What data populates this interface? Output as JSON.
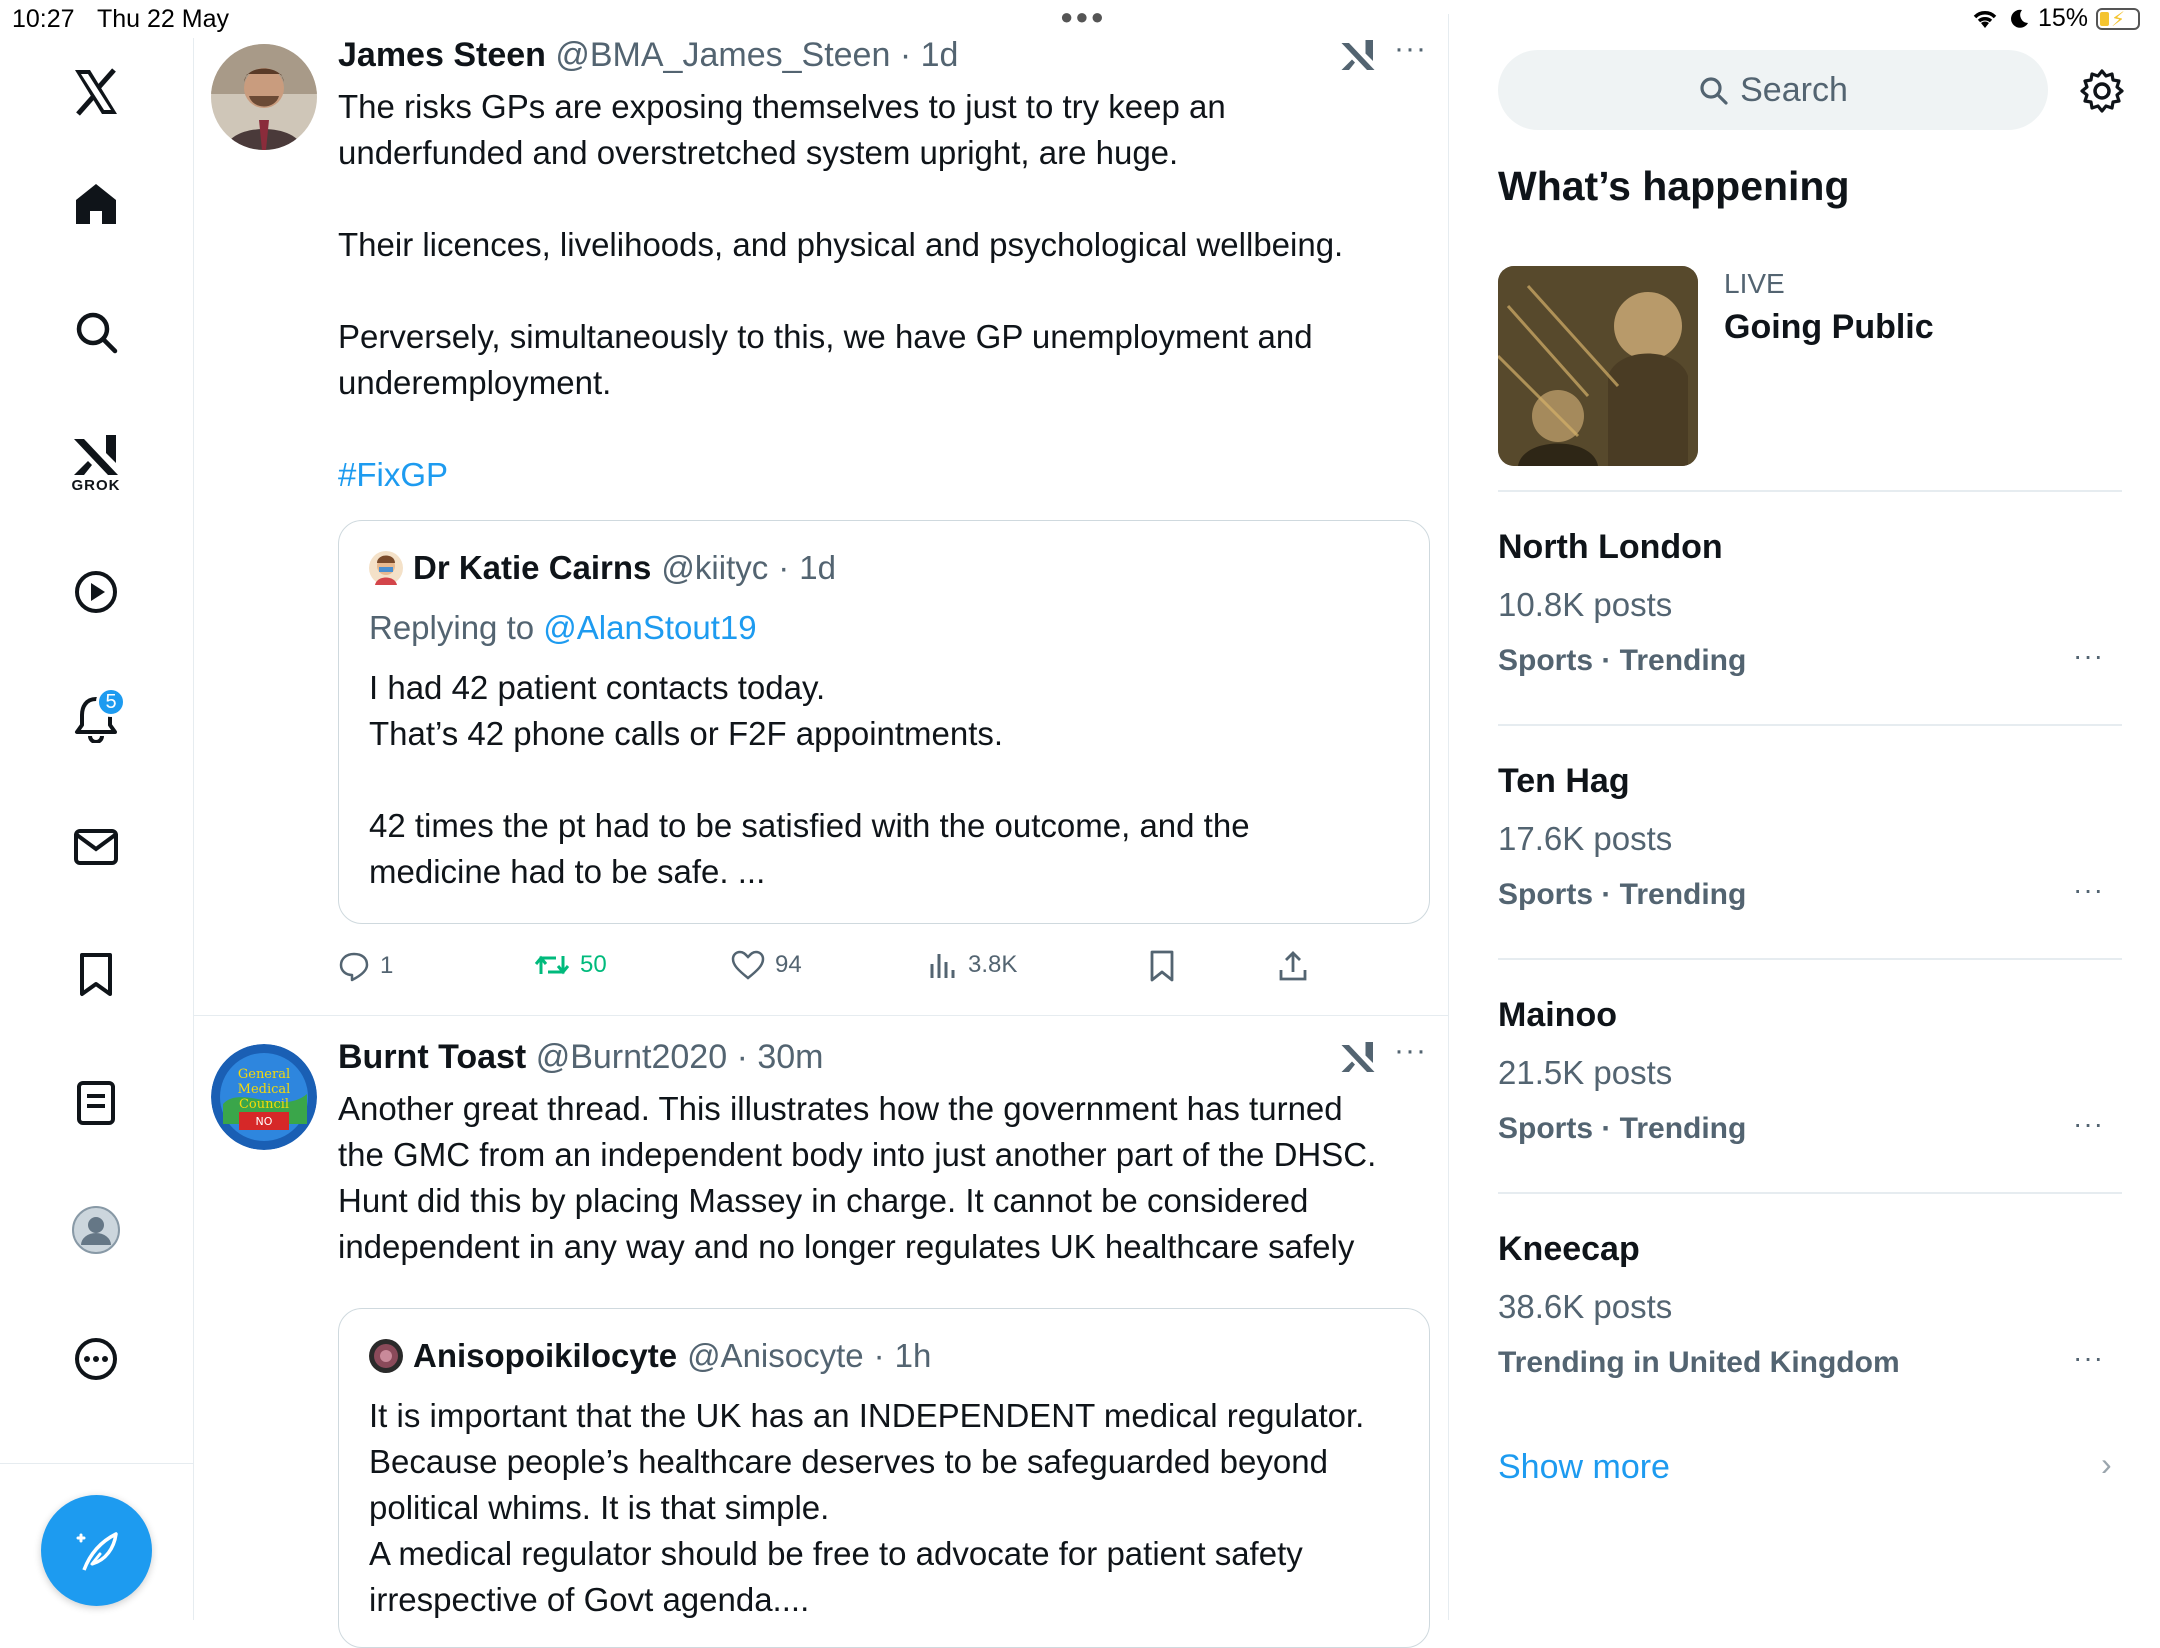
{
  "status_bar": {
    "time": "10:27",
    "date": "Thu 22 May",
    "battery": "15%"
  },
  "nav": {
    "grok_label": "GROK",
    "notifications_badge": "5"
  },
  "posts": [
    {
      "name": "James Steen",
      "handle": "@BMA_James_Steen",
      "age": "1d",
      "text": "The risks GPs are exposing themselves to just to try keep an\nunderfunded and overstretched system upright, are huge.\n\nTheir licences, livelihoods, and physical and psychological wellbeing.\n\nPerversely, simultaneously to this, we have GP unemployment and\nunderemployment.",
      "hashtag": "#FixGP",
      "quote": {
        "name": "Dr Katie Cairns",
        "handle": "@kiityc",
        "age": "1d",
        "replying_prefix": "Replying to ",
        "replying_to": "@AlanStout19",
        "text": "I had 42 patient contacts today.\nThat’s 42 phone calls or F2F appointments.\n\n42 times the pt had to be satisfied with the outcome, and the\nmedicine had to be safe. ..."
      },
      "replies": "1",
      "reposts": "50",
      "likes": "94",
      "views": "3.8K"
    },
    {
      "name": "Burnt Toast",
      "handle": "@Burnt2020",
      "age": "30m",
      "text": "Another great thread. This illustrates how the government has turned\nthe GMC from an independent body into just another part of the DHSC.\nHunt did this by placing Massey in charge. It cannot be considered\nindependent in any way and no longer regulates UK healthcare safely",
      "quote": {
        "name": "Anisopoikilocyte",
        "handle": "@Anisocyte",
        "age": "1h",
        "text": "It is important that the UK has an INDEPENDENT medical regulator.\nBecause people’s healthcare deserves to be safeguarded beyond\npolitical whims. It is that simple.\nA medical regulator should be free to advocate for patient safety\nirrespective of Govt agenda...."
      }
    }
  ],
  "sidebar": {
    "search_placeholder": "Search",
    "title": "What’s happening",
    "live": {
      "label": "LIVE",
      "title": "Going Public"
    },
    "trends": [
      {
        "name": "North London",
        "posts": "10.8K posts",
        "category": "Sports · Trending"
      },
      {
        "name": "Ten Hag",
        "posts": "17.6K posts",
        "category": "Sports · Trending"
      },
      {
        "name": "Mainoo",
        "posts": "21.5K posts",
        "category": "Sports · Trending"
      },
      {
        "name": "Kneecap",
        "posts": "38.6K posts",
        "category": "Trending in United Kingdom"
      }
    ],
    "show_more": "Show more"
  },
  "colors": {
    "accent": "#1d9bf0",
    "repost_green": "#00ba7c",
    "muted": "#536471"
  }
}
